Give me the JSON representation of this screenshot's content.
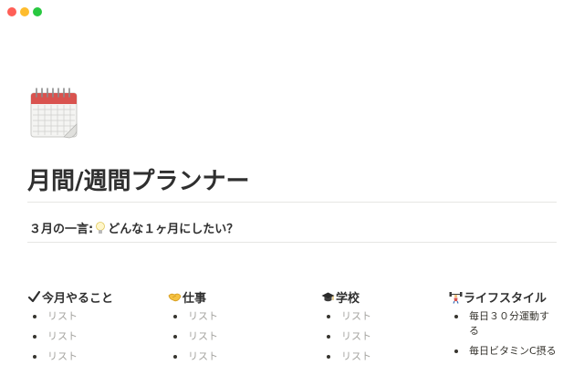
{
  "window": {
    "controls": [
      "close",
      "minimize",
      "zoom"
    ],
    "colors": {
      "close": "#ff5f57",
      "minimize": "#febc2e",
      "zoom": "#28c840"
    }
  },
  "page": {
    "icon": "spiral-calendar-icon",
    "title": "月間/週間プランナー",
    "callout": {
      "prefix": "３月の一言:",
      "icon": "light-bulb-icon",
      "text": "どんな１ヶ月にしたい？"
    }
  },
  "columns": [
    {
      "icon": "check-mark-icon",
      "heading": "今月やること",
      "items": [
        "リスト",
        "リスト",
        "リスト"
      ]
    },
    {
      "icon": "handshake-icon",
      "heading": "仕事",
      "items": [
        "リスト",
        "リスト",
        "リスト"
      ]
    },
    {
      "icon": "graduation-cap-icon",
      "heading": "学校",
      "items": [
        "リスト",
        "リスト",
        "リスト"
      ]
    },
    {
      "icon": "weightlifter-icon",
      "heading": "ライフスタイル",
      "items": [
        "毎日３０分運動する",
        "毎日ビタミンC摂る"
      ]
    }
  ]
}
